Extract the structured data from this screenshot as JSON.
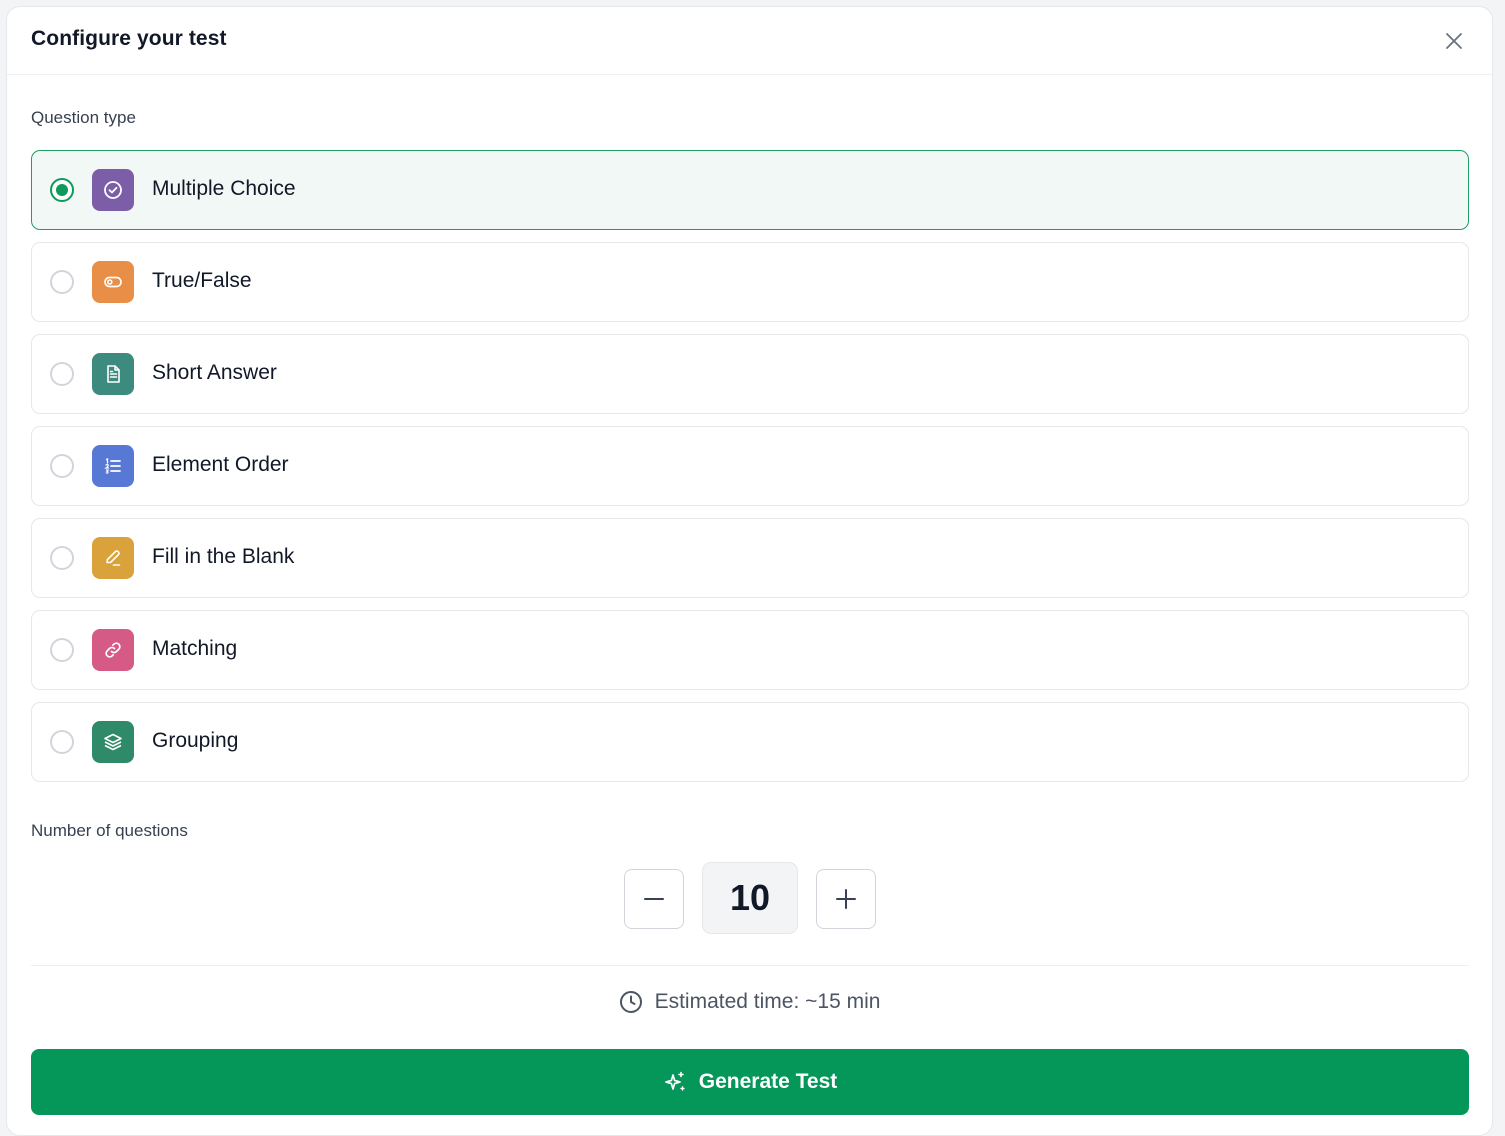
{
  "dialog": {
    "title": "Configure your test",
    "close_icon": "close-icon"
  },
  "question_type": {
    "label": "Question type",
    "selected": "Multiple Choice",
    "options": [
      {
        "label": "Multiple Choice",
        "icon": "check-circle-icon",
        "color": "#7c5ea8"
      },
      {
        "label": "True/False",
        "icon": "toggle-icon",
        "color": "#e98e46"
      },
      {
        "label": "Short Answer",
        "icon": "document-icon",
        "color": "#3d8a7e"
      },
      {
        "label": "Element Order",
        "icon": "ordered-list-icon",
        "color": "#5878d6"
      },
      {
        "label": "Fill in the Blank",
        "icon": "pencil-icon",
        "color": "#d9a23a"
      },
      {
        "label": "Matching",
        "icon": "link-icon",
        "color": "#d65a86"
      },
      {
        "label": "Grouping",
        "icon": "layers-icon",
        "color": "#2f8a6a"
      }
    ]
  },
  "questions": {
    "label": "Number of questions",
    "count": "10",
    "decrement_icon": "minus-icon",
    "increment_icon": "plus-icon"
  },
  "estimate": {
    "icon": "clock-icon",
    "text": "Estimated time: ~15 min"
  },
  "generate": {
    "icon": "sparkles-icon",
    "label": "Generate Test",
    "color": "#05975a"
  }
}
